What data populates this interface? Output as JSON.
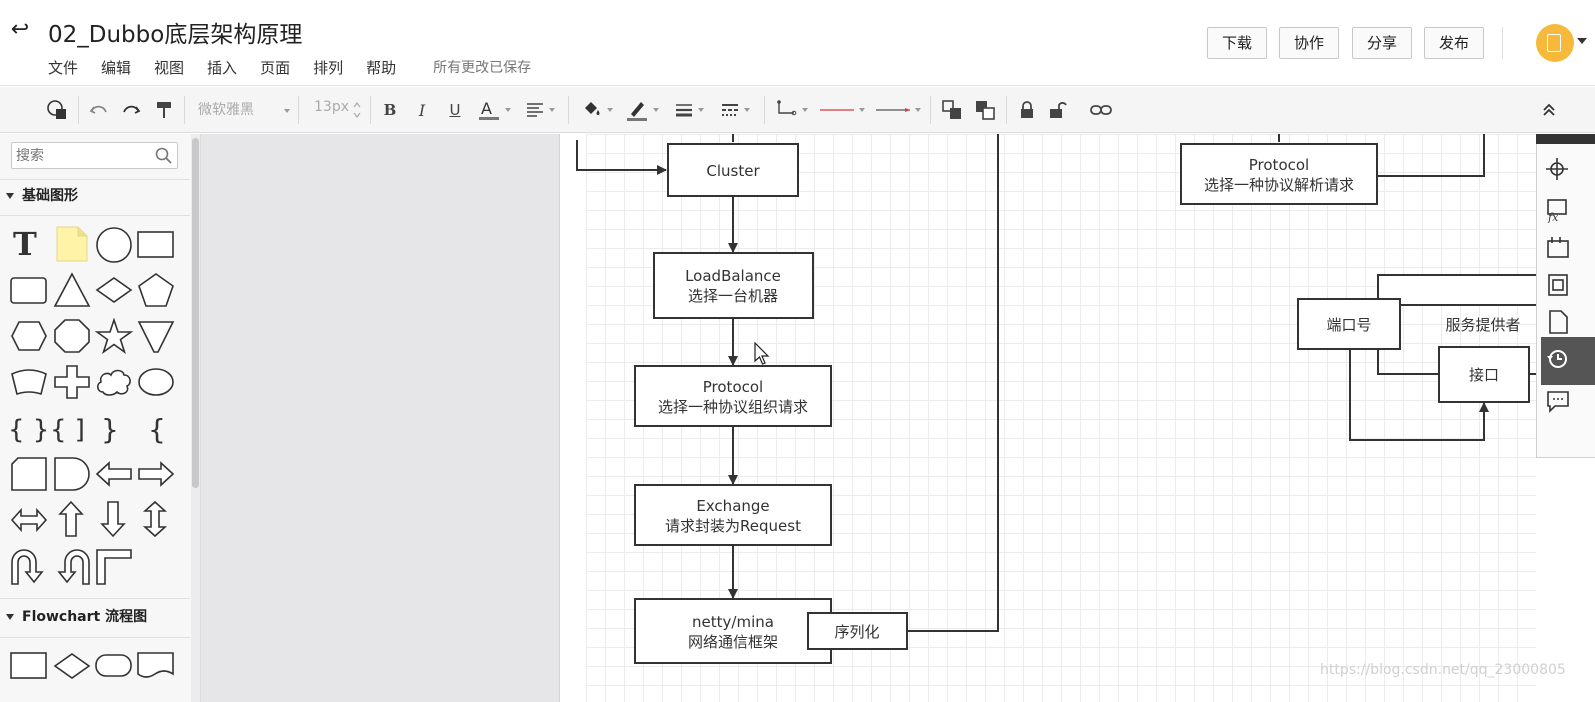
{
  "header": {
    "title": "02_Dubbo底层架构原理",
    "menu": [
      "文件",
      "编辑",
      "视图",
      "插入",
      "页面",
      "排列",
      "帮助"
    ],
    "save_status": "所有更改已保存",
    "buttons": {
      "download": "下载",
      "collaborate": "协作",
      "share": "分享",
      "publish": "发布"
    },
    "accent_color": "#f6b93b"
  },
  "toolbar": {
    "font_family": "微软雅黑",
    "font_size": "13px",
    "icons": [
      "style-icon",
      "undo-icon",
      "redo-icon",
      "format-painter-icon",
      "bold-icon",
      "italic-icon",
      "underline-icon",
      "font-color-icon",
      "align-icon",
      "fill-color-icon",
      "line-color-icon",
      "line-width-icon",
      "line-style-icon",
      "connector-icon",
      "start-arrow-icon",
      "end-arrow-icon",
      "bring-front-icon",
      "send-back-icon",
      "lock-icon",
      "unlock-icon",
      "link-icon",
      "collapse-icon"
    ]
  },
  "sidebar": {
    "search_placeholder": "搜索",
    "sections": [
      {
        "label": "基础图形"
      },
      {
        "label": "Flowchart 流程图"
      }
    ]
  },
  "diagram": {
    "nodes": {
      "cluster": {
        "line1": "Cluster"
      },
      "loadbalance": {
        "line1": "LoadBalance",
        "line2": "选择一台机器"
      },
      "protocol_left": {
        "line1": "Protocol",
        "line2": "选择一种协议组织请求"
      },
      "exchange": {
        "line1": "Exchange",
        "line2": "请求封装为Request"
      },
      "netty": {
        "line1": "netty/mina",
        "line2": "网络通信框架"
      },
      "serialize": {
        "line1": "序列化"
      },
      "protocol_right": {
        "line1": "Protocol",
        "line2": "选择一种协议解析请求"
      },
      "provider": {
        "line1": "服务提供者"
      },
      "port": {
        "line1": "端口号"
      },
      "interface": {
        "line1": "接口"
      }
    }
  },
  "watermark": "https://blog.csdn.net/qq_23000805"
}
